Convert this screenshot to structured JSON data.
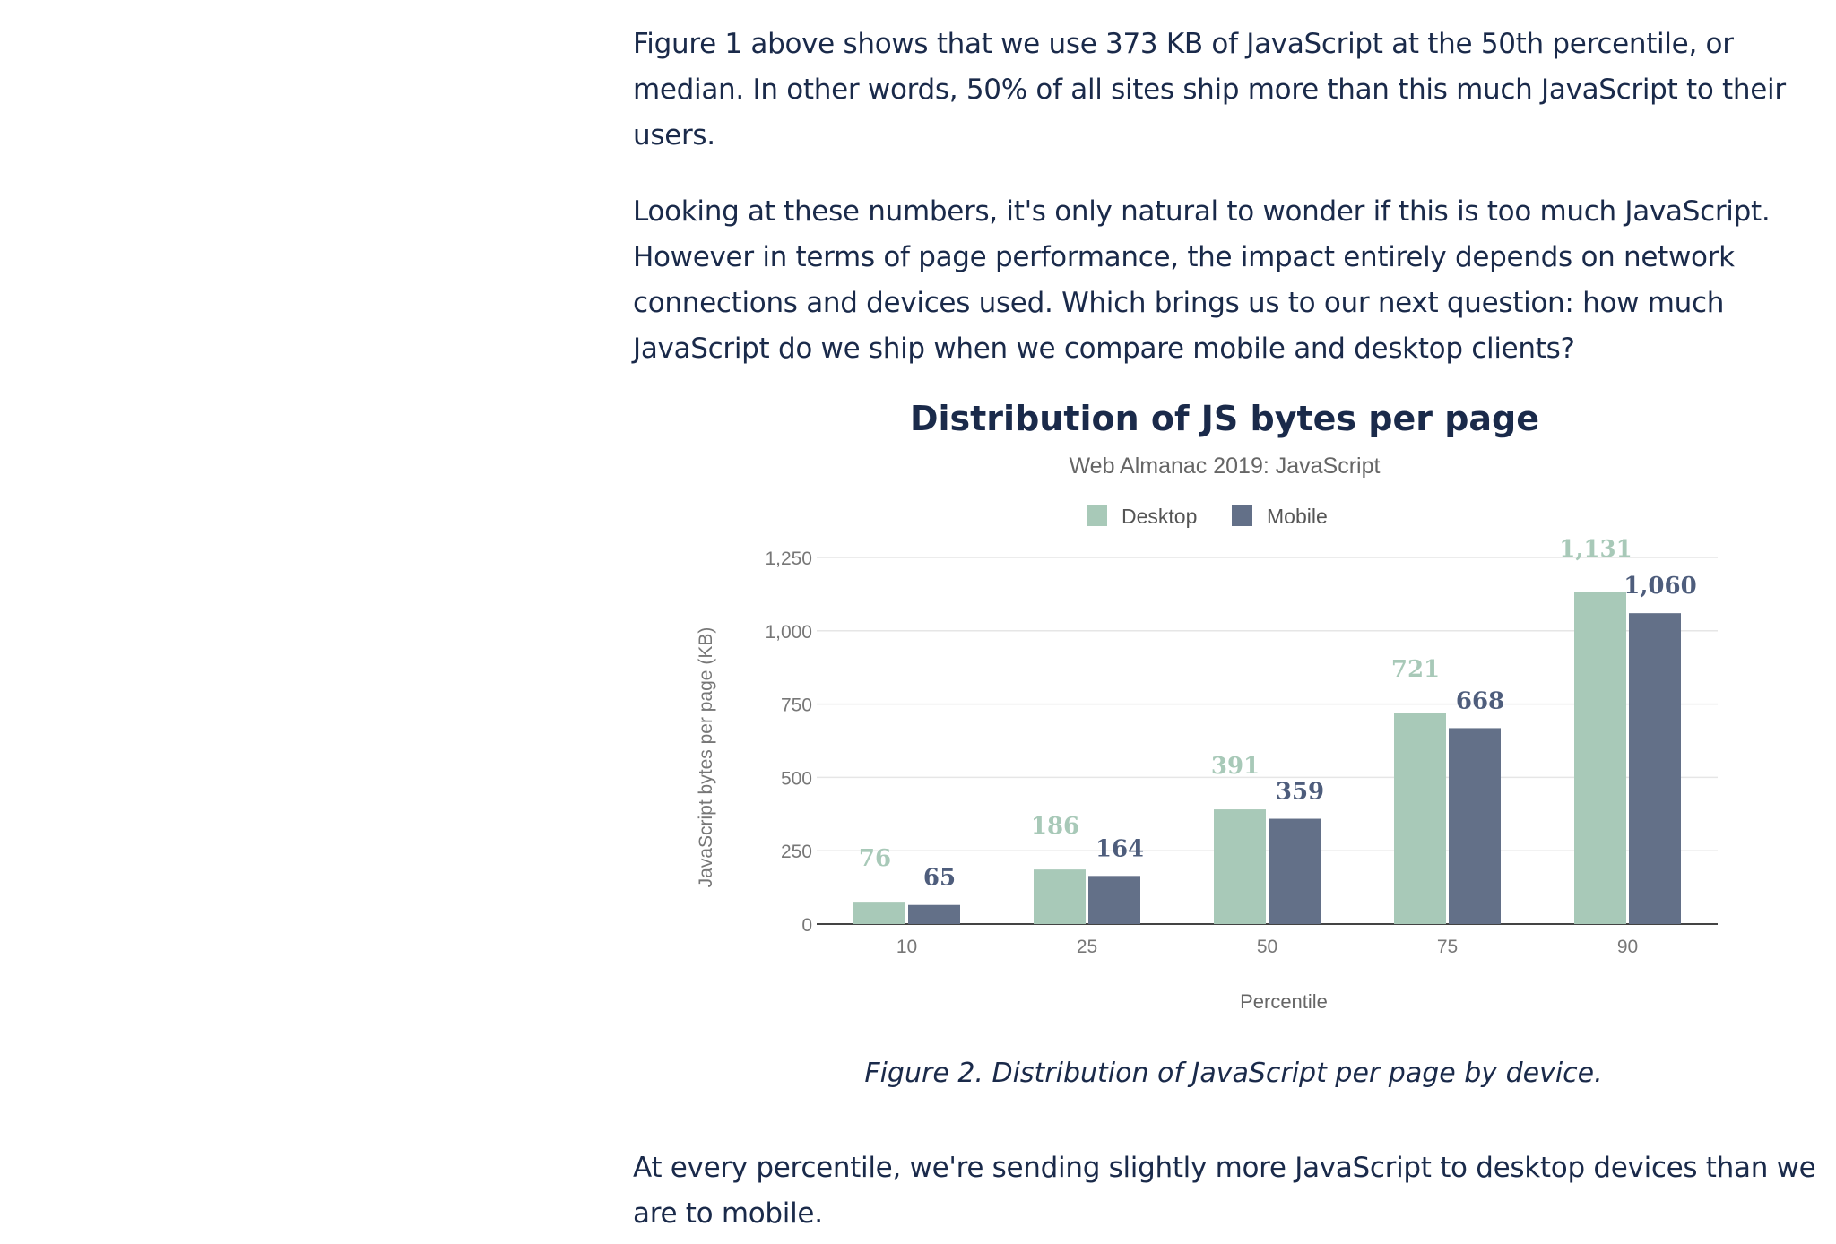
{
  "article": {
    "paragraph_1": "Figure 1 above shows that we use 373 KB of JavaScript at the 50th percentile, or median. In other words, 50% of all sites ship more than this much JavaScript to their users.",
    "paragraph_2": "Looking at these numbers, it's only natural to wonder if this is too much JavaScript. However in terms of page performance, the impact entirely depends on network connections and devices used. Which brings us to our next question: how much JavaScript do we ship when we compare mobile and desktop clients?",
    "caption": "Figure 2. Distribution of JavaScript per page by device.",
    "paragraph_3": "At every percentile, we're sending slightly more JavaScript to desktop devices than we are to mobile."
  },
  "chart_data": {
    "type": "bar",
    "title": "Distribution of JS bytes per page",
    "subtitle": "Web Almanac 2019: JavaScript",
    "xlabel": "Percentile",
    "ylabel": "JavaScript bytes per page (KB)",
    "categories": [
      "10",
      "25",
      "50",
      "75",
      "90"
    ],
    "series": [
      {
        "name": "Desktop",
        "values": [
          76,
          186,
          391,
          721,
          1131
        ],
        "labels": [
          "76",
          "186",
          "391",
          "721",
          "1,131"
        ],
        "color": "#a8c9b8"
      },
      {
        "name": "Mobile",
        "values": [
          65,
          164,
          359,
          668,
          1060
        ],
        "labels": [
          "65",
          "164",
          "359",
          "668",
          "1,060"
        ],
        "color": "#637088"
      }
    ],
    "ylim": [
      0,
      1250
    ],
    "yticks": [
      0,
      250,
      500,
      750,
      1000,
      1250
    ],
    "ytick_labels": [
      "0",
      "250",
      "500",
      "750",
      "1,000",
      "1,250"
    ],
    "grid": true,
    "legend_position": "top"
  }
}
